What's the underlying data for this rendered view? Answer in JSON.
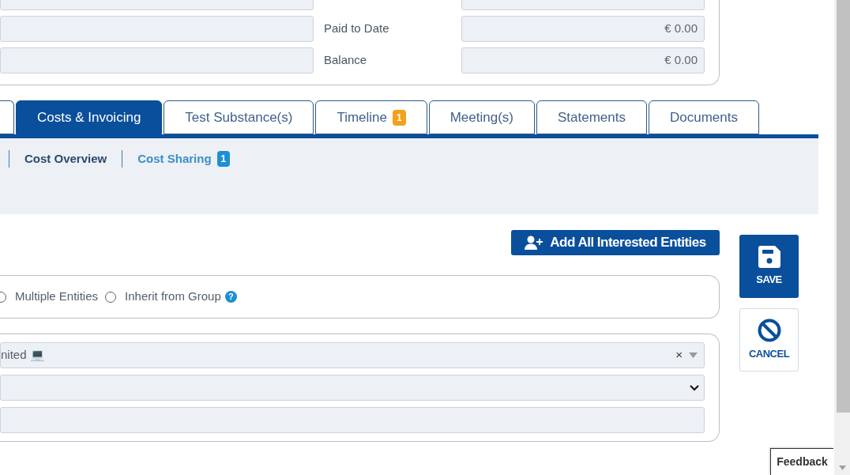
{
  "summary": [
    {
      "kind": "cut"
    },
    {
      "label": "Paid to Date",
      "value": "€ 0.00"
    },
    {
      "label": "Balance",
      "value": "€ 0.00"
    }
  ],
  "tabs": [
    {
      "selected": false
    },
    {
      "label": "Costs & Invoicing",
      "selected": true
    },
    {
      "label": "Test Substance(s)",
      "selected": false
    },
    {
      "label": "Timeline",
      "badge": "1",
      "selected": false
    },
    {
      "label": "Meeting(s)",
      "selected": false
    },
    {
      "label": "Statements",
      "selected": false
    },
    {
      "label": "Documents",
      "selected": false
    }
  ],
  "subnav": [
    {
      "label": "Cost Overview",
      "selected": true
    },
    {
      "label": "Cost Sharing",
      "badge": "1",
      "selected": false
    }
  ],
  "add_button": "Add All Interested Entities",
  "radios": [
    {
      "label": "Multiple Entities",
      "selected": false
    },
    {
      "label": "Inherit from Group",
      "selected": false,
      "help": "?"
    }
  ],
  "entity_select": {
    "value": "nited 💻",
    "clear": "×"
  },
  "save": "SAVE",
  "cancel": "CANCEL",
  "feedback": "Feedback"
}
